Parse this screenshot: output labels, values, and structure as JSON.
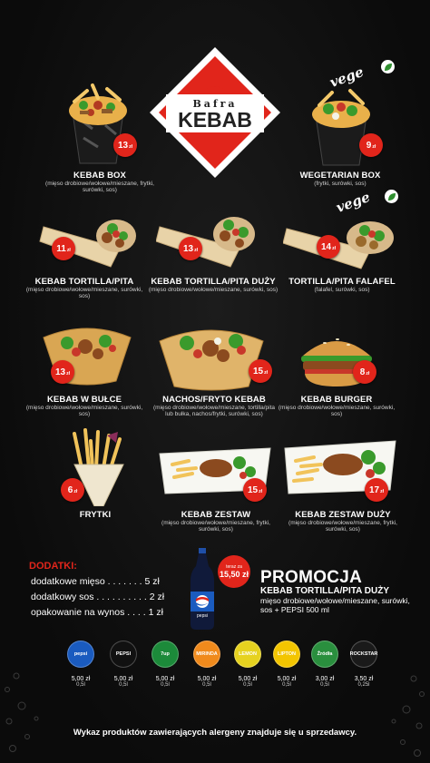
{
  "logo": {
    "small": "Bafra",
    "big": "KEBAB"
  },
  "vege_label": "vege",
  "items": [
    {
      "name": "KEBAB BOX",
      "desc": "(mięso drobiowe/wołowe/mieszane, frytki, surówki, sos)",
      "price": "13",
      "currency": "zł"
    },
    {
      "name": "WEGETARIAN BOX",
      "desc": "(frytki, surówki, sos)",
      "price": "9",
      "currency": "zł"
    },
    {
      "name": "KEBAB TORTILLA/PITA",
      "desc": "(mięso drobiowe/wołowe/mieszane, surówki, sos)",
      "price": "11",
      "currency": "zł"
    },
    {
      "name": "KEBAB TORTILLA/PITA DUŻY",
      "desc": "(mięso drobiowe/wołowe/mieszane, surówki, sos)",
      "price": "13",
      "currency": "zł"
    },
    {
      "name": "TORTILLA/PITA FALAFEL",
      "desc": "(falafel, surówki, sos)",
      "price": "14",
      "currency": "zł"
    },
    {
      "name": "KEBAB W BUŁCE",
      "desc": "(mięso drobiowe/wołowe/mieszane, surówki, sos)",
      "price": "13",
      "currency": "zł"
    },
    {
      "name": "NACHOS/FRYTO KEBAB",
      "desc": "(mięso drobiowe/wołowe/mieszane, tortilla/pita lub bułka, nachos/frytki, surówki, sos)",
      "price": "15",
      "currency": "zł"
    },
    {
      "name": "KEBAB BURGER",
      "desc": "(mięso drobiowe/wołowe/mieszane, surówki, sos)",
      "price": "8",
      "currency": "zł"
    },
    {
      "name": "FRYTKI",
      "desc": "",
      "price": "6",
      "currency": "zł"
    },
    {
      "name": "KEBAB ZESTAW",
      "desc": "(mięso drobiowe/wołowe/mieszane, frytki, surówki, sos)",
      "price": "15",
      "currency": "zł"
    },
    {
      "name": "KEBAB ZESTAW DUŻY",
      "desc": "(mięso drobiowe/wołowe/mieszane, frytki, surówki, sos)",
      "price": "17",
      "currency": "zł"
    }
  ],
  "dodatki": {
    "title": "DODATKI:",
    "rows": [
      "dodatkowe mięso . . . . . . . 5 zł",
      "dodatkowy sos . . . . . . . . . . 2 zł",
      "opakowanie na wynos . . . . 1 zł"
    ]
  },
  "promo": {
    "badge_small": "teraz za",
    "badge_price": "15,50 zł",
    "title": "PROMOCJA",
    "subtitle": "KEBAB TORTILLA/PITA DUŻY",
    "desc": "mięso drobiowe/wołowe/mieszane, surówki, sos + PEPSI 500 ml",
    "bottle_label": "pepsi"
  },
  "drinks": [
    {
      "label": "pepsi",
      "price": "5,00 zł",
      "vol": "0,5l",
      "color": "#1a5bbf"
    },
    {
      "label": "PEPSI",
      "price": "5,00 zł",
      "vol": "0,5l",
      "color": "#111111"
    },
    {
      "label": "7up",
      "price": "5,00 zł",
      "vol": "0,5l",
      "color": "#1c8a3a"
    },
    {
      "label": "MIRINDA",
      "price": "5,00 zł",
      "vol": "0,5l",
      "color": "#f08a1c"
    },
    {
      "label": "LEMON",
      "price": "5,00 zł",
      "vol": "0,5l",
      "color": "#e6d21f"
    },
    {
      "label": "LIPTON",
      "price": "5,00 zł",
      "vol": "0,5l",
      "color": "#f3c500"
    },
    {
      "label": "Źródła",
      "price": "3,00 zł",
      "vol": "0,5l",
      "color": "#2a8f3e"
    },
    {
      "label": "ROCKSTAR",
      "price": "3,50 zł",
      "vol": "0,25l",
      "color": "#1a1a1a"
    }
  ],
  "footer": "Wykaz produktów zawierających alergeny znajduje się u sprzedawcy."
}
